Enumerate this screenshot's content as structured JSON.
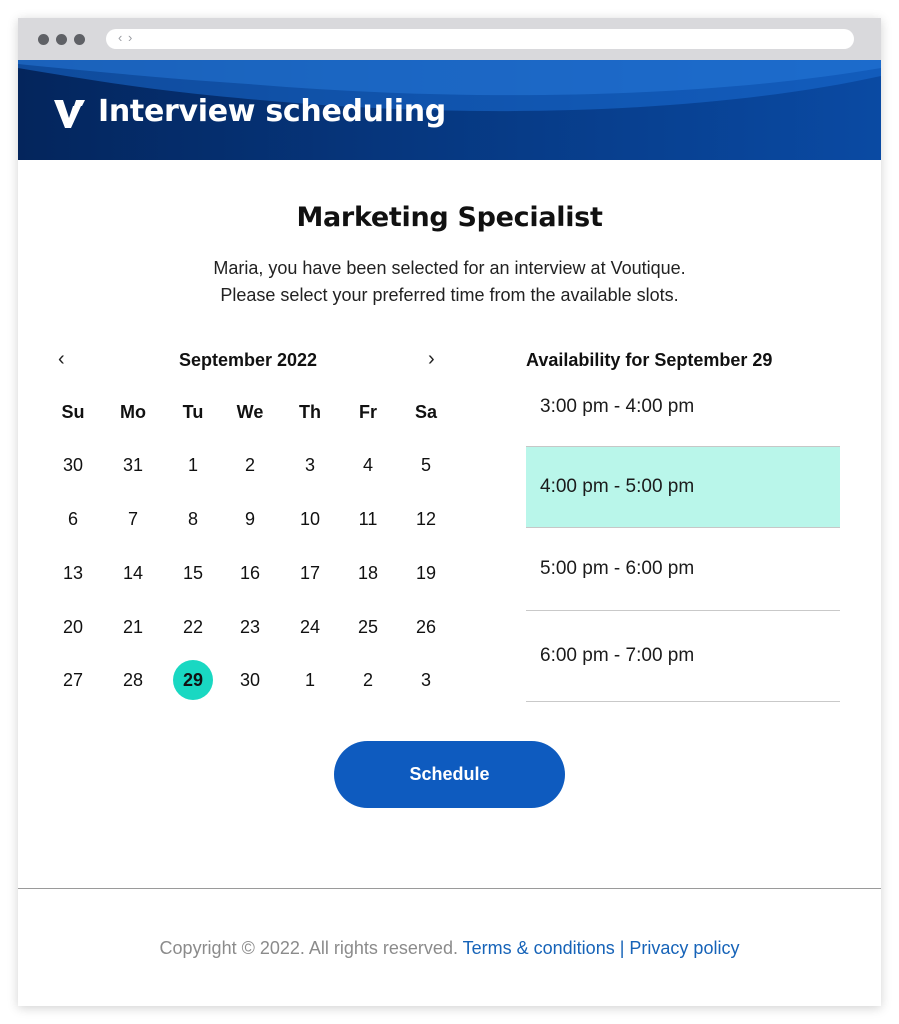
{
  "app": {
    "title": "Interview scheduling",
    "logo": "V-logo"
  },
  "job": {
    "title": "Marketing Specialist",
    "line1": "Maria, you have been selected for an interview at Voutique.",
    "line2": "Please select your preferred time from the available slots."
  },
  "calendar": {
    "month": "September 2022",
    "prev_icon": "chevron-left-icon",
    "next_icon": "chevron-right-icon",
    "weekdays": [
      "Su",
      "Mo",
      "Tu",
      "We",
      "Th",
      "Fr",
      "Sa"
    ],
    "weeks": [
      [
        "30",
        "31",
        "1",
        "2",
        "3",
        "4",
        "5"
      ],
      [
        "6",
        "7",
        "8",
        "9",
        "10",
        "11",
        "12"
      ],
      [
        "13",
        "14",
        "15",
        "16",
        "17",
        "18",
        "19"
      ],
      [
        "20",
        "21",
        "22",
        "23",
        "24",
        "25",
        "26"
      ],
      [
        "27",
        "28",
        "29",
        "30",
        "1",
        "2",
        "3"
      ]
    ],
    "selected_day": "29",
    "selected_color": "#19d8c2"
  },
  "availability": {
    "title": "Availability for September 29",
    "slots": [
      "3:00 pm - 4:00 pm",
      "4:00 pm - 5:00 pm",
      "5:00 pm - 6:00 pm",
      "6:00 pm - 7:00 pm"
    ],
    "selected_slot": "4:00 pm - 5:00 pm",
    "selected_color": "#b9f6ea"
  },
  "actions": {
    "schedule_label": "Schedule",
    "button_color": "#0e5bbf"
  },
  "footer": {
    "copyright": "Copyright © 2022. All rights reserved.",
    "terms": "Terms & conditions",
    "separator": "|",
    "privacy": "Privacy policy"
  }
}
